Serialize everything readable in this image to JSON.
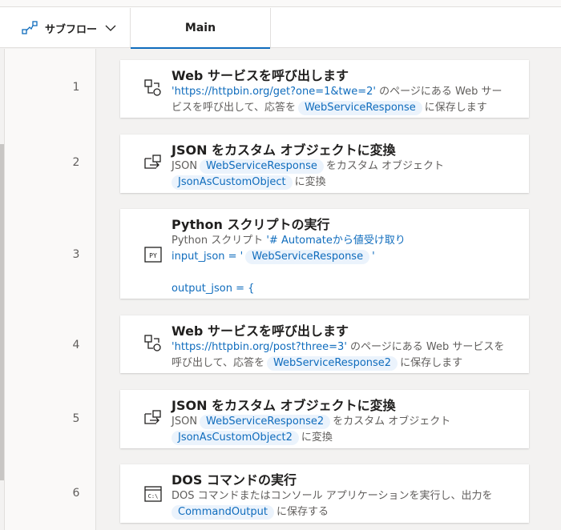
{
  "header": {
    "subflow_label": "サブフロー",
    "tab_main": "Main"
  },
  "steps": [
    {
      "number": "1",
      "title": "Web サービスを呼び出します",
      "url": "'https://httpbin.org/get?one=1&twe=2'",
      "text1": "のページにある Web サー",
      "text2": "ビスを呼び出して、応答を",
      "var": "WebServiceResponse",
      "text3": "に保存します"
    },
    {
      "number": "2",
      "title": "JSON をカスタム オブジェクトに変換",
      "prefix": "JSON",
      "var1": "WebServiceResponse",
      "middle": "をカスタム オブジェクト",
      "var2": "JsonAsCustomObject",
      "suffix": "に変換"
    },
    {
      "number": "3",
      "title": "Python スクリプトの実行",
      "prefix": "Python スクリプト",
      "line1": "'# Automateから値受け取り",
      "line2a": "input_json = '",
      "var": "WebServiceResponse",
      "line2b": "'",
      "line3": "output_json = {"
    },
    {
      "number": "4",
      "title": "Web サービスを呼び出します",
      "url": "'https://httpbin.org/post?three=3'",
      "text1": "のページにある Web サービスを",
      "text2": "呼び出して、応答を",
      "var": "WebServiceResponse2",
      "text3": "に保存します"
    },
    {
      "number": "5",
      "title": "JSON をカスタム オブジェクトに変換",
      "prefix": "JSON",
      "var1": "WebServiceResponse2",
      "middle": "をカスタム オブジェクト",
      "var2": "JsonAsCustomObject2",
      "suffix": "に変換"
    },
    {
      "number": "6",
      "title": "DOS コマンドの実行",
      "text1": "DOS コマンドまたはコンソール アプリケーションを実行し、出力を",
      "var": "CommandOutput",
      "text2": "に保存する"
    }
  ],
  "icons": {
    "subflow": "subflow-icon",
    "chevron": "chevron-down-icon",
    "web_service": "web-service-icon",
    "json_convert": "convert-icon",
    "python": "python-script-icon",
    "dos": "dos-command-icon"
  },
  "colors": {
    "accent": "#0f6cbd",
    "pill_bg": "#ebf3fc"
  }
}
